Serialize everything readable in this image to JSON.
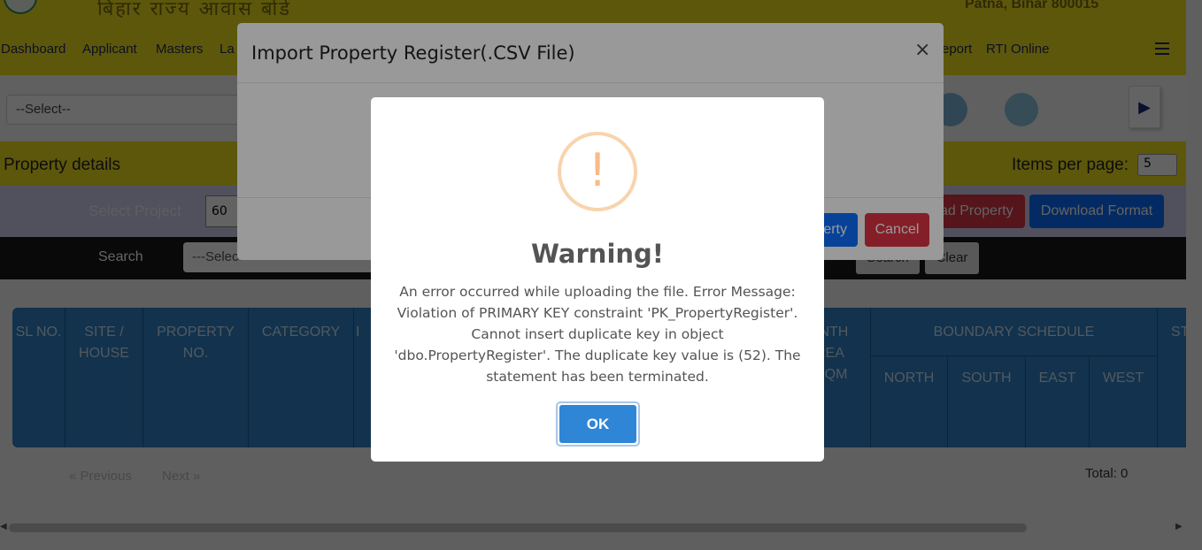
{
  "header": {
    "hindi_title": "बिहार राज्य आवास बोर्ड",
    "address": "Patna, Bihar 800015"
  },
  "nav": {
    "items": [
      "Dashboard",
      "Applicant",
      "Masters",
      "La",
      "eport",
      "RTI Online"
    ]
  },
  "toolbar": {
    "select_value": "--Select--"
  },
  "property": {
    "title": "Property details",
    "items_per_page_label": "Items per page:",
    "items_per_page_value": "5"
  },
  "project": {
    "label": "Select Project",
    "value": "60",
    "upload_button": "ad Property",
    "download_button": "Download Format"
  },
  "search": {
    "label": "Search",
    "select_value": "---Selec",
    "search_button": "Search",
    "clear_button": "Clear"
  },
  "table": {
    "columns": [
      "SL NO.",
      "SITE / HOUSE",
      "PROPERTY NO.",
      "CATEGORY",
      "I",
      "INTH REA SQM",
      "BOUNDARY SCHEDULE",
      "ST"
    ],
    "boundary_sub": [
      "NORTH",
      "SOUTH",
      "EAST",
      "WEST"
    ]
  },
  "pagination": {
    "previous": "«  Previous",
    "next": "Next  »",
    "total": "Total: 0"
  },
  "import_modal": {
    "title": "Import Property Register(.CSV File)",
    "close": "×",
    "import_button": "Import Property",
    "cancel_button": "Cancel"
  },
  "alert": {
    "icon": "!",
    "title": "Warning!",
    "message": "An error occurred while uploading the file. Error Message: Violation of PRIMARY KEY constraint 'PK_PropertyRegister'. Cannot insert duplicate key in object 'dbo.PropertyRegister'. The duplicate key value is (52). The statement has been terminated.",
    "ok_button": "OK"
  }
}
